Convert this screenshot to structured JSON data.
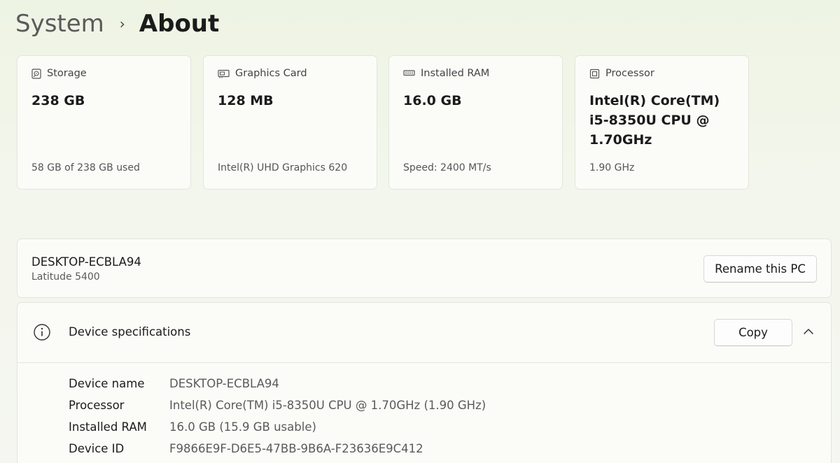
{
  "breadcrumb": {
    "parent": "System",
    "separator": "›",
    "current": "About"
  },
  "cards": [
    {
      "icon": "storage-icon",
      "label": "Storage",
      "value": "238 GB",
      "detail": "58 GB of 238 GB used"
    },
    {
      "icon": "graphics-card-icon",
      "label": "Graphics Card",
      "value": "128 MB",
      "detail": "Intel(R) UHD Graphics 620"
    },
    {
      "icon": "ram-icon",
      "label": "Installed RAM",
      "value": "16.0 GB",
      "detail": "Speed: 2400 MT/s"
    },
    {
      "icon": "processor-icon",
      "label": "Processor",
      "value": "Intel(R) Core(TM) i5-8350U CPU @ 1.70GHz",
      "detail": "1.90 GHz"
    }
  ],
  "pc": {
    "name": "DESKTOP-ECBLA94",
    "model": "Latitude 5400",
    "rename_label": "Rename this PC"
  },
  "specs": {
    "title": "Device specifications",
    "copy_label": "Copy",
    "rows": [
      {
        "key": "Device name",
        "value": "DESKTOP-ECBLA94"
      },
      {
        "key": "Processor",
        "value": "Intel(R) Core(TM) i5-8350U CPU @ 1.70GHz (1.90 GHz)"
      },
      {
        "key": "Installed RAM",
        "value": "16.0 GB (15.9 GB usable)"
      },
      {
        "key": "Device ID",
        "value": "F9866E9F-D6E5-47BB-9B6A-F23636E9C412"
      }
    ]
  }
}
